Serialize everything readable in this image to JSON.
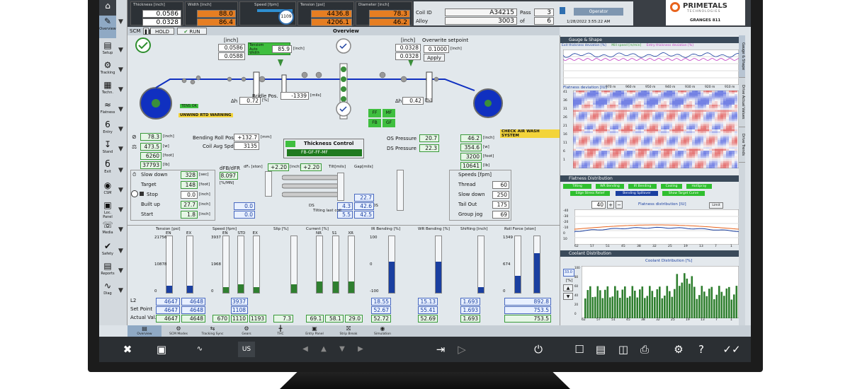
{
  "header": {
    "thickness": {
      "label": "Thickness [inch]",
      "v1": "0.0586",
      "v2": "0.0328"
    },
    "width": {
      "label": "Width [inch]",
      "v1": "88.0",
      "v2": "86.4"
    },
    "speed": {
      "label": "Speed [fpm]",
      "dial": "1109"
    },
    "tension": {
      "label": "Tension [psi]",
      "v1": "4436.8",
      "v2": "4206.1"
    },
    "diameter": {
      "label": "Diameter [inch]",
      "v1": "78.3",
      "v2": "46.2"
    },
    "coil_id_label": "Coil ID",
    "coil_id": "A34215",
    "alloy_label": "Alloy",
    "alloy": "3003",
    "pass_label": "Pass",
    "pass": "3",
    "of_label": "of",
    "of": "6",
    "role": "Operator",
    "datetime": "1/28/2022 3:55:22 AM",
    "plant": "GRANGES 811",
    "brand": "PRIMETALS",
    "brand_sub": "TECHNOLOGIES"
  },
  "nav": [
    {
      "label": "Overview",
      "icon": "home-icon"
    },
    {
      "label": "Setup",
      "icon": "setup-icon"
    },
    {
      "label": "Tracking",
      "icon": "tracking-icon"
    },
    {
      "label": "Techn.",
      "icon": "techn-icon"
    },
    {
      "label": "Flatness",
      "icon": "flatness-icon"
    },
    {
      "label": "Entry",
      "icon": "entry-icon"
    },
    {
      "label": "Stand",
      "icon": "stand-icon"
    },
    {
      "label": "Exit",
      "icon": "exit-icon"
    },
    {
      "label": "CSM",
      "icon": "csm-icon"
    },
    {
      "label": "Loc. Panel",
      "icon": "panel-icon"
    },
    {
      "label": "Media",
      "icon": "media-icon"
    },
    {
      "label": "Safety",
      "icon": "safety-icon"
    },
    {
      "label": "Reports",
      "icon": "reports-icon"
    },
    {
      "label": "Diag",
      "icon": "diag-icon"
    }
  ],
  "toolbar": {
    "scm": "SCM",
    "hold": "HOLD",
    "run": "RUN",
    "title": "Overview"
  },
  "overview": {
    "tensiometer": {
      "unit": "[inch]",
      "v1": "0.0586",
      "v2": "0.0588",
      "t1": "Tensiom",
      "t2": "Auto",
      "t3": "Width",
      "width_val": "85.9",
      "width_unit": "[inch]"
    },
    "right_thk": {
      "unit": "[inch]",
      "v1": "0.0328",
      "v2": "0.0328"
    },
    "overwrite_label": "Overwrite setpoint",
    "overwrite_val": "0.1000",
    "overwrite_unit": "[inch]",
    "apply": "Apply",
    "dh_left": "0.72",
    "dh_left_unit": "[%]",
    "dh_right": "0.42",
    "dh_right_unit": "[%]",
    "bridle_label": "Bridle Pos.",
    "bridle_val": "-1339",
    "bridle_unit": "[mils]",
    "tension_ok": "TENS OK",
    "unwind_warn": "UNWIND RTD WARNING",
    "air_warn": "CHECK AIR WASH SYSTEM",
    "ff": "FF",
    "mf": "MF",
    "fb": "FB",
    "gf": "GF",
    "left_coil": [
      {
        "v": "78.3",
        "u": "[inch]"
      },
      {
        "v": "473.5",
        "u": "[w]"
      },
      {
        "v": "6260",
        "u": "[foot]"
      },
      {
        "v": "37793",
        "u": "[lb]"
      }
    ],
    "bending_label": "Bending Roll Pos.",
    "bending_val": "+132.7",
    "bending_unit": "[mm]",
    "coilspd_label": "Coil Avg Spd",
    "coilspd_val": "3135",
    "tc_title": "Thickness Control",
    "tc_mode": "FB-GF-FF-MF",
    "os_label": "OS Pressure",
    "os_val": "20.7",
    "ds_label": "DS Pressure",
    "ds_val": "22.3",
    "right_coil": [
      {
        "v": "46.2",
        "u": "[inch]"
      },
      {
        "v": "354.6",
        "u": "[w]"
      },
      {
        "v": "3200",
        "u": "[foot]"
      },
      {
        "v": "10641",
        "u": "[lb]"
      }
    ],
    "slowdown": {
      "label": "Slow down",
      "val": "328",
      "unit": "[sec]"
    },
    "target": {
      "label": "Target",
      "val": "148",
      "unit": "[foot]"
    },
    "stop": {
      "label": "Stop",
      "val": "0.0",
      "unit": "[inch]"
    },
    "builtup": {
      "label": "Built up",
      "val": "27.7",
      "unit": "[inch]"
    },
    "start": {
      "label": "Start",
      "val": "1.8",
      "unit": "[inch]"
    },
    "dfb_label": "dFB/dFR",
    "dfb_val": "8.097",
    "dfb_unit": "[%/MN]",
    "dfs_label": "dFₛ [ston]",
    "dfs_val1": "+2.20",
    "dfs_unit": "[inch]",
    "dfs_val2": "+2.20",
    "tilt_label": "Tilt[mils]",
    "gap_label": "Gap[mils]",
    "ds_small": "DS",
    "os_small": "OS",
    "zero1": "0.0",
    "zero2": "0.0",
    "tilt_v1": "4.3",
    "tilt_v2": "5.5",
    "gap_v0": "22.7",
    "gap_v1": "42.6",
    "gap_v2": "42.5",
    "tilting_label": "Tilting last coil",
    "speeds_label": "Speeds [fpm]",
    "thread": {
      "label": "Thread",
      "val": "60"
    },
    "slowdown2": {
      "label": "Slow down",
      "val": "250"
    },
    "tailout": {
      "label": "Tail Out",
      "val": "175"
    },
    "groupjog": {
      "label": "Group jog",
      "val": "69"
    }
  },
  "gauges": {
    "row_labels": [
      "L2",
      "Set Point",
      "Actual Val."
    ],
    "groups": [
      {
        "title": "Tension [psi]",
        "cols": [
          "EN",
          "EX"
        ],
        "scale": [
          "21756",
          "10878",
          "0"
        ],
        "scale2": "21756",
        "scale3": "10878",
        "fills": [
          0.12,
          0.12
        ],
        "l2": [
          "4647",
          "4648"
        ],
        "sp": [
          "4647",
          "4648"
        ],
        "av": [
          "4647",
          "4648"
        ]
      },
      {
        "title": "Speed [fpm]",
        "cols": [
          "EN",
          "STD",
          "EX"
        ],
        "scale": [
          "3937",
          "1968",
          "0"
        ],
        "fills": [
          0.1,
          0.15,
          0.1
        ],
        "l2": [
          "",
          "3937",
          ""
        ],
        "sp": [
          "",
          "1108",
          ""
        ],
        "av": [
          "670",
          "1110",
          "1193"
        ]
      },
      {
        "title": "Slip [%]",
        "cols": [
          ""
        ],
        "fills": [
          0.15
        ],
        "av": [
          "7.3"
        ]
      },
      {
        "title": "Current [%]",
        "cols": [
          "NR",
          "S1",
          "XR"
        ],
        "fills": [
          0.2,
          0.2,
          0.2
        ],
        "av": [
          "69.1",
          "58.1",
          "29.0"
        ]
      },
      {
        "title": "IR Bending [%]",
        "scale": [
          "100",
          "0",
          "-100"
        ],
        "fills": [
          0.55
        ],
        "l2": [
          "18.55"
        ],
        "sp": [
          "52.67"
        ],
        "av": [
          "52.72"
        ]
      },
      {
        "title": "WR Bending [%]",
        "fills": [
          0.55
        ],
        "l2": [
          "15.13"
        ],
        "sp": [
          "55.41"
        ],
        "av": [
          "52.69"
        ]
      },
      {
        "title": "Shifting [inch]",
        "fills": [
          0.1
        ],
        "l2": [
          "1.693"
        ],
        "sp": [
          "1.693"
        ],
        "av": [
          "1.693"
        ]
      },
      {
        "title": "Roll Force [ston]",
        "scale": [
          "1349",
          "674",
          "0"
        ],
        "fills": [
          0.3,
          0.7
        ],
        "l2": [
          "892.8"
        ],
        "sp": [
          "753.5"
        ],
        "av": [
          "753.5"
        ]
      }
    ]
  },
  "right_panel": {
    "gauge_title": "Gauge & Shape",
    "gauge_legend": [
      "Exit thickness deviation [%]",
      "Mill speed [m/min]",
      "Entry thickness deviation [%]"
    ],
    "flat_dev": "Flatness deviation [IU]",
    "x_ticks": [
      "970 m",
      "960 m",
      "950 m",
      "940 m",
      "930 m",
      "920 m",
      "910 m"
    ],
    "y_ticks": [
      "41",
      "36",
      "31",
      "26",
      "21",
      "16",
      "11",
      "6",
      "1"
    ],
    "flat_title": "Flatness Distribution",
    "flat_btns": [
      "Tilting",
      "WR Bending",
      "IR Bending",
      "Cooling",
      "HotSpray",
      "Edge Stress Relief",
      "Bending Spillover",
      "Show Target Curve"
    ],
    "flat_num": "40",
    "flat_plus": "+",
    "flat_minus": "−",
    "flat_chart_title": "Flatness distribution  [IU]",
    "flat_limit": "Limit",
    "flat_y": [
      "-40",
      "-30",
      "-20",
      "-10",
      "0",
      "10"
    ],
    "flat_x": [
      "62",
      "57",
      "51",
      "45",
      "38",
      "32",
      "25",
      "19",
      "13",
      "7",
      "1"
    ],
    "coolant_title": "Coolant Distribution",
    "coolant_chart_title": "Coolant Distribution  [%]",
    "coolant_val": "33.0",
    "coolant_unit": "[%]",
    "coolant_y": [
      "100",
      "80",
      "60",
      "40",
      "20",
      "0"
    ],
    "coolant_x": [
      "62",
      "57",
      "51",
      "45",
      "38",
      "32",
      "25",
      "19",
      "13",
      "7",
      "1"
    ],
    "vtabs": [
      "Gauge & Shape",
      "Drive Actual Values",
      "Drive Trends"
    ]
  },
  "bottom_tabs": [
    "Overview",
    "SCM Modes",
    "Tracking Sync",
    "Gears",
    "THC",
    "Entry Panel",
    "Strip Break",
    "Simulation"
  ],
  "taskbar": {
    "lang": "US"
  },
  "colors": {
    "accent": "#1a3fa0",
    "green": "#2f8f2f",
    "orange": "#e67e22",
    "header": "#3a3f45"
  }
}
